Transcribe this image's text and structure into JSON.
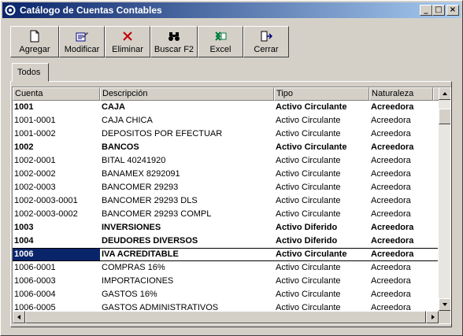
{
  "window": {
    "title": "Catálogo de Cuentas Contables"
  },
  "titlebar_buttons": {
    "minimize": "_",
    "maximize": "□",
    "close": "×"
  },
  "toolbar": {
    "agregar": "Agregar",
    "modificar": "Modificar",
    "eliminar": "Eliminar",
    "buscar": "Buscar F2",
    "excel": "Excel",
    "cerrar": "Cerrar"
  },
  "tabs": {
    "todos": "Todos"
  },
  "columns": {
    "cuenta": "Cuenta",
    "descripcion": "Descripción",
    "tipo": "Tipo",
    "naturaleza": "Naturaleza"
  },
  "rows": [
    {
      "cuenta": "1001",
      "descripcion": "CAJA",
      "tipo": "Activo Circulante",
      "naturaleza": "Acreedora",
      "bold": true
    },
    {
      "cuenta": "1001-0001",
      "descripcion": "CAJA CHICA",
      "tipo": "Activo Circulante",
      "naturaleza": "Acreedora"
    },
    {
      "cuenta": "1001-0002",
      "descripcion": "DEPOSITOS POR EFECTUAR",
      "tipo": "Activo Circulante",
      "naturaleza": "Acreedora"
    },
    {
      "cuenta": "1002",
      "descripcion": "BANCOS",
      "tipo": "Activo Circulante",
      "naturaleza": "Acreedora",
      "bold": true
    },
    {
      "cuenta": "1002-0001",
      "descripcion": "BITAL 40241920",
      "tipo": "Activo Circulante",
      "naturaleza": "Acreedora"
    },
    {
      "cuenta": "1002-0002",
      "descripcion": "BANAMEX 8292091",
      "tipo": "Activo Circulante",
      "naturaleza": "Acreedora"
    },
    {
      "cuenta": "1002-0003",
      "descripcion": "BANCOMER 29293",
      "tipo": "Activo Circulante",
      "naturaleza": "Acreedora"
    },
    {
      "cuenta": "1002-0003-0001",
      "descripcion": "BANCOMER 29293 DLS",
      "tipo": "Activo Circulante",
      "naturaleza": "Acreedora"
    },
    {
      "cuenta": "1002-0003-0002",
      "descripcion": "BANCOMER 29293 COMPL",
      "tipo": "Activo Circulante",
      "naturaleza": "Acreedora"
    },
    {
      "cuenta": "1003",
      "descripcion": "INVERSIONES",
      "tipo": "Activo Diferido",
      "naturaleza": "Acreedora",
      "bold": true
    },
    {
      "cuenta": "1004",
      "descripcion": "DEUDORES DIVERSOS",
      "tipo": "Activo Diferido",
      "naturaleza": "Acreedora",
      "bold": true
    },
    {
      "cuenta": "1006",
      "descripcion": "IVA ACREDITABLE",
      "tipo": "Activo Circulante",
      "naturaleza": "Acreedora",
      "bold": true,
      "selected": true
    },
    {
      "cuenta": "1006-0001",
      "descripcion": "COMPRAS 16%",
      "tipo": "Activo Circulante",
      "naturaleza": "Acreedora"
    },
    {
      "cuenta": "1006-0003",
      "descripcion": "IMPORTACIONES",
      "tipo": "Activo Circulante",
      "naturaleza": "Acreedora"
    },
    {
      "cuenta": "1006-0004",
      "descripcion": "GASTOS 16%",
      "tipo": "Activo Circulante",
      "naturaleza": "Acreedora"
    },
    {
      "cuenta": "1006-0005",
      "descripcion": "GASTOS ADMINISTRATIVOS",
      "tipo": "Activo Circulante",
      "naturaleza": "Acreedora"
    }
  ],
  "colors": {
    "title_start": "#0a246a",
    "title_end": "#a6caf0",
    "selection": "#0a246a",
    "face": "#d4d0c8"
  }
}
